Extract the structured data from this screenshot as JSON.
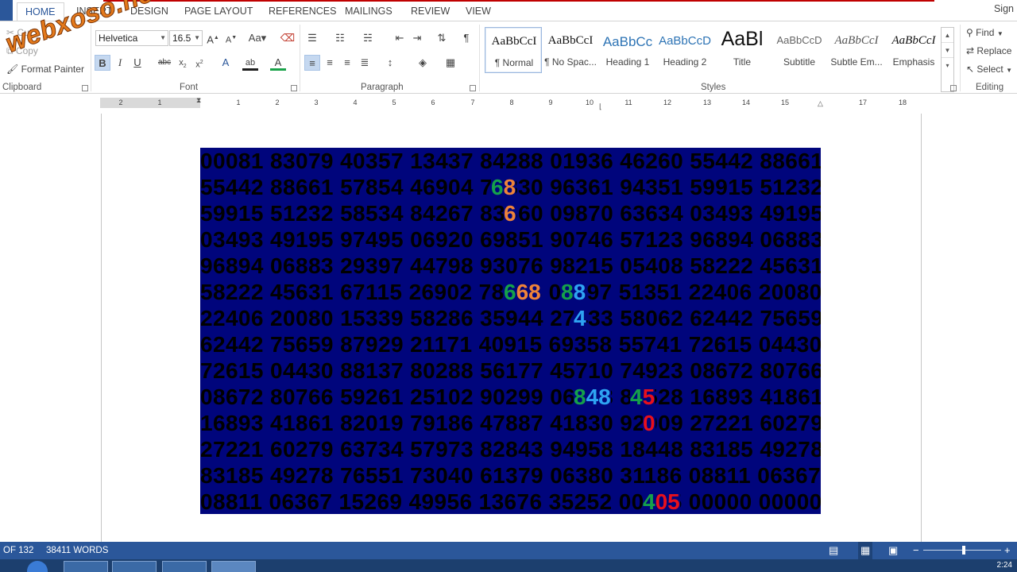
{
  "tabs": [
    {
      "label": "HOME",
      "active": true
    },
    {
      "label": "INSERT"
    },
    {
      "label": "DESIGN"
    },
    {
      "label": "PAGE LAYOUT"
    },
    {
      "label": "REFERENCES"
    },
    {
      "label": "MAILINGS"
    },
    {
      "label": "REVIEW"
    },
    {
      "label": "VIEW"
    }
  ],
  "signin": "Sign",
  "clipboard": {
    "cut": "Cut",
    "copy": "Copy",
    "format_painter": "Format Painter",
    "label": "Clipboard"
  },
  "font": {
    "name": "Helvetica",
    "size": "16.5",
    "label": "Font"
  },
  "paragraph": {
    "label": "Paragraph"
  },
  "styles": {
    "label": "Styles",
    "items": [
      {
        "sample": "AaBbCcI",
        "name": "¶ Normal"
      },
      {
        "sample": "AaBbCcI",
        "name": "¶ No Spac..."
      },
      {
        "sample": "AaBbCc",
        "name": "Heading 1"
      },
      {
        "sample": "AaBbCcD",
        "name": "Heading 2"
      },
      {
        "sample": "AaBl",
        "name": "Title"
      },
      {
        "sample": "AaBbCcD",
        "name": "Subtitle"
      },
      {
        "sample": "AaBbCcI",
        "name": "Subtle Em..."
      },
      {
        "sample": "AaBbCcI",
        "name": "Emphasis"
      }
    ]
  },
  "editing": {
    "find": "Find",
    "replace": "Replace",
    "select": "Select",
    "label": "Editing"
  },
  "ruler": {
    "labels": [
      "2",
      "1",
      "",
      "1",
      "2",
      "3",
      "4",
      "5",
      "6",
      "7",
      "8",
      "9",
      "10",
      "11",
      "12",
      "13",
      "14",
      "15",
      "",
      "17",
      "18"
    ]
  },
  "document": {
    "rows": [
      "00081 83079 40357 13437 84288 01936 46260 55442 88661",
      "55442 88661 57854 46904 76830 96361 94351 59915 51232",
      "59915 51232 58534 84267 83660 09870 63634 03493 49195",
      "03493 49195 97495 06920 69851 90746 57123 96894 06883",
      "96894 06883 29397 44798 93076 98215 05408 58222 45631",
      "58222 45631 67115 26902 78668 08897 51351 22406 20080",
      "22406 20080 15339 58286 35944 27433 58062 62442 75659",
      "62442 75659 87929 21171 40915 69358 55741 72615 04430",
      "72615 04430 88137 80288 56177 45710 74923 08672 80766",
      "08672 80766 59261 25102 90299 06848 84528 16893 41861",
      "16893 41861 82019 79186 47887 41830 92009 27221 60279",
      "27221 60279 63734 57973 82843 94958 18448 83185 49278",
      "83185 49278 76551 73040 61379 06380 31186 08811 06367",
      "08811 06367 15269 49956 13676 35252 00405 00000 00000"
    ],
    "highlights": {
      "h1": [
        "6",
        "8"
      ],
      "h2": [
        "6"
      ],
      "h3": [
        "6",
        "68"
      ],
      "h4": [
        "8",
        "8"
      ],
      "h5": [
        "4"
      ],
      "h6": [
        "8",
        "48"
      ],
      "h7": [
        "4",
        "5"
      ],
      "h8": [
        "0"
      ],
      "h9": [
        "4",
        "05"
      ]
    }
  },
  "status": {
    "page": "OF 132",
    "words": "38411 WORDS"
  },
  "watermark": "webxoso.net",
  "clock": "2:24"
}
